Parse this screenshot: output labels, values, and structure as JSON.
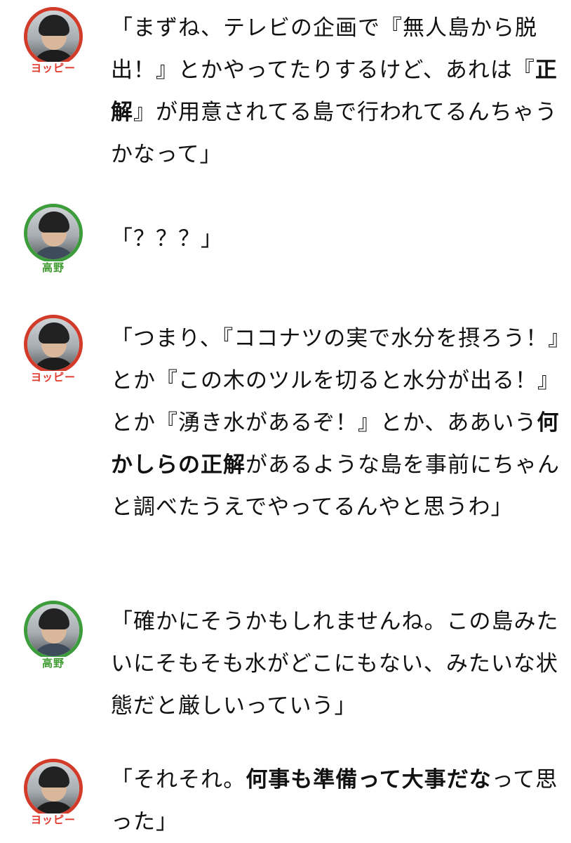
{
  "dialogue": [
    {
      "speaker": "ヨッピー",
      "color": "#d23a2a",
      "segments": [
        {
          "text": "「まずね、テレビの企画で『無人島から脱出！』とかやってたりするけど、あれは『",
          "bold": false
        },
        {
          "text": "正解",
          "bold": true
        },
        {
          "text": "』が用意されてる島で行われてるんちゃうかなって」",
          "bold": false
        }
      ]
    },
    {
      "speaker": "高野",
      "color": "#3d9d3d",
      "segments": [
        {
          "text": "「？？？」",
          "bold": false
        }
      ]
    },
    {
      "speaker": "ヨッピー",
      "color": "#d23a2a",
      "segments": [
        {
          "text": "「つまり、『ココナツの実で水分を摂ろう！』とか『この木のツルを切ると水分が出る！』とか『湧き水があるぞ！』とか、ああいう",
          "bold": false
        },
        {
          "text": "何かしらの正解",
          "bold": true
        },
        {
          "text": "があるような島を事前にちゃんと調べたうえでやってるんやと思うわ」",
          "bold": false
        }
      ]
    },
    {
      "speaker": "高野",
      "color": "#3d9d3d",
      "segments": [
        {
          "text": "「確かにそうかもしれませんね。この島みたいにそもそも水がどこにもない、みたいな状態だと厳しいっていう」",
          "bold": false
        }
      ]
    },
    {
      "speaker": "ヨッピー",
      "color": "#d23a2a",
      "segments": [
        {
          "text": "「それそれ。",
          "bold": false
        },
        {
          "text": "何事も準備って大事だな",
          "bold": true
        },
        {
          "text": "って思った」",
          "bold": false
        }
      ]
    }
  ]
}
